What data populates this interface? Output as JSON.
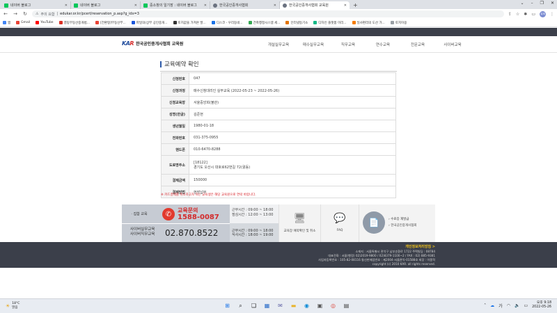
{
  "browser": {
    "tabs": [
      {
        "label": "네이버 블로그",
        "color": "#03c75a",
        "active": false
      },
      {
        "label": "네이버 블로그",
        "color": "#03c75a",
        "active": false
      },
      {
        "label": "중소창의 일기장 : 네이버 블로그",
        "color": "#03c75a",
        "active": false
      },
      {
        "label": "한국공인중개사협회",
        "color": "#6b7280",
        "active": false
      },
      {
        "label": "한국공인중개사협회 교육원",
        "color": "#6b7280",
        "active": true
      }
    ],
    "newtab": "+",
    "address": {
      "warning": "주의 요함",
      "url": "edukar.or.kr/pcert/reservation_p.asp?g_idx=3"
    },
    "profile": "유재",
    "bookmarks": [
      {
        "label": "앱",
        "color": "#4285f4"
      },
      {
        "label": "Gmail",
        "color": "#ea4335"
      },
      {
        "label": "YouTube",
        "color": "#ff0000"
      },
      {
        "label": "결동부동산중개법...",
        "color": "#d93025"
      },
      {
        "label": "[전환형]부동산부...",
        "color": "#ea4335"
      },
      {
        "label": "파일의(상부 공인중개...",
        "color": "#1a56db"
      },
      {
        "label": "토지값을 가져온 발...",
        "color": "#333333"
      },
      {
        "label": "디스코 - 우리동네...",
        "color": "#1a73e8"
      },
      {
        "label": "건축행정시스템 세...",
        "color": "#34a853"
      },
      {
        "label": "인터넷등기소",
        "color": "#e37400"
      },
      {
        "label": "디자인 플랫폼 미리...",
        "color": "#12b886"
      },
      {
        "label": "일사편리의 도산 가...",
        "color": "#f57c00"
      },
      {
        "label": "토지이용",
        "color": "#9aa0a6"
      }
    ]
  },
  "site": {
    "logo_mark_k": "KA",
    "logo_mark_r": "R",
    "logo_text": "한국공인중개사협회 교육원",
    "nav": [
      "개설실무교육",
      "매수실무교육",
      "직무교육",
      "연수교육",
      "전문교육",
      "사이버교육"
    ]
  },
  "page": {
    "title": "교육예약 확인",
    "rows": [
      {
        "label": "신청번호",
        "value": "047"
      },
      {
        "label": "신청과정",
        "value": "매수신청대리인 실무교육 (2022-05-23 ~ 2022-05-26)"
      },
      {
        "label": "신청교육장",
        "value": "서울중앙회(불관)"
      },
      {
        "label": "성명(한글)",
        "value": "김준현"
      },
      {
        "label": "생년월일",
        "value": "1980-01-18"
      },
      {
        "label": "전화번호",
        "value": "031-375-0955"
      },
      {
        "label": "핸드폰",
        "value": "010-6470-8288"
      },
      {
        "label": "도로명주소",
        "value": "[18122]",
        "value2": "경기도 오산시 대호로62번길 72(궐동)"
      },
      {
        "label": "결제금액",
        "value": "150000"
      },
      {
        "label": "결제방법",
        "value": "현장납부"
      }
    ],
    "notice": "※ 카드결제를 취소하고자 하는 교육생은 해당 교육원으로 연락 바랍니다."
  },
  "banner": {
    "left_label": "· 집합 교육",
    "inquiry_label": "교육문의",
    "inquiry_number": "1588-0087",
    "cyber_line1": "사이버실무교육",
    "cyber_line2": "사이버직무교육",
    "cyber_number": "02.870.8522",
    "hours1_line1": "근무시간 : 09:00 ~ 18:00",
    "hours1_line2": "점심시간 : 12:00 ~ 13:00",
    "hours2_line1": "근무시간 : 09:00 ~ 18:00",
    "hours2_line2": "식사시간 : 18:00 ~ 19:00",
    "box1_caption": "교육장 예약확인 및 취소",
    "box2_caption": "FAQ",
    "right_link1": "› 수료증 재발급",
    "right_link2": "› 한국공인중개사협회"
  },
  "footer": {
    "privacy": "개인정보처리방침 >",
    "line1": "소재지 : 서울특별시 관악구 남부순환로 1722 주택빌딩 : 08784",
    "line2": "대표전화 : 서울(행정) 02)2019-9800 / 02)8379-1100~2 / FAX : 02) 885-9381",
    "line3": "사업자등록번호 : 105-82-08116 통신판매업번호 : 제2004-서울관악-01588호 회장 : 이종혁",
    "line4": "copyright (c) 2010 KAR. all rights reserved."
  },
  "taskbar": {
    "weather_temp": "18°C",
    "weather_desc": "맑음",
    "time": "오후 9:18",
    "date": "2022-05-26"
  }
}
